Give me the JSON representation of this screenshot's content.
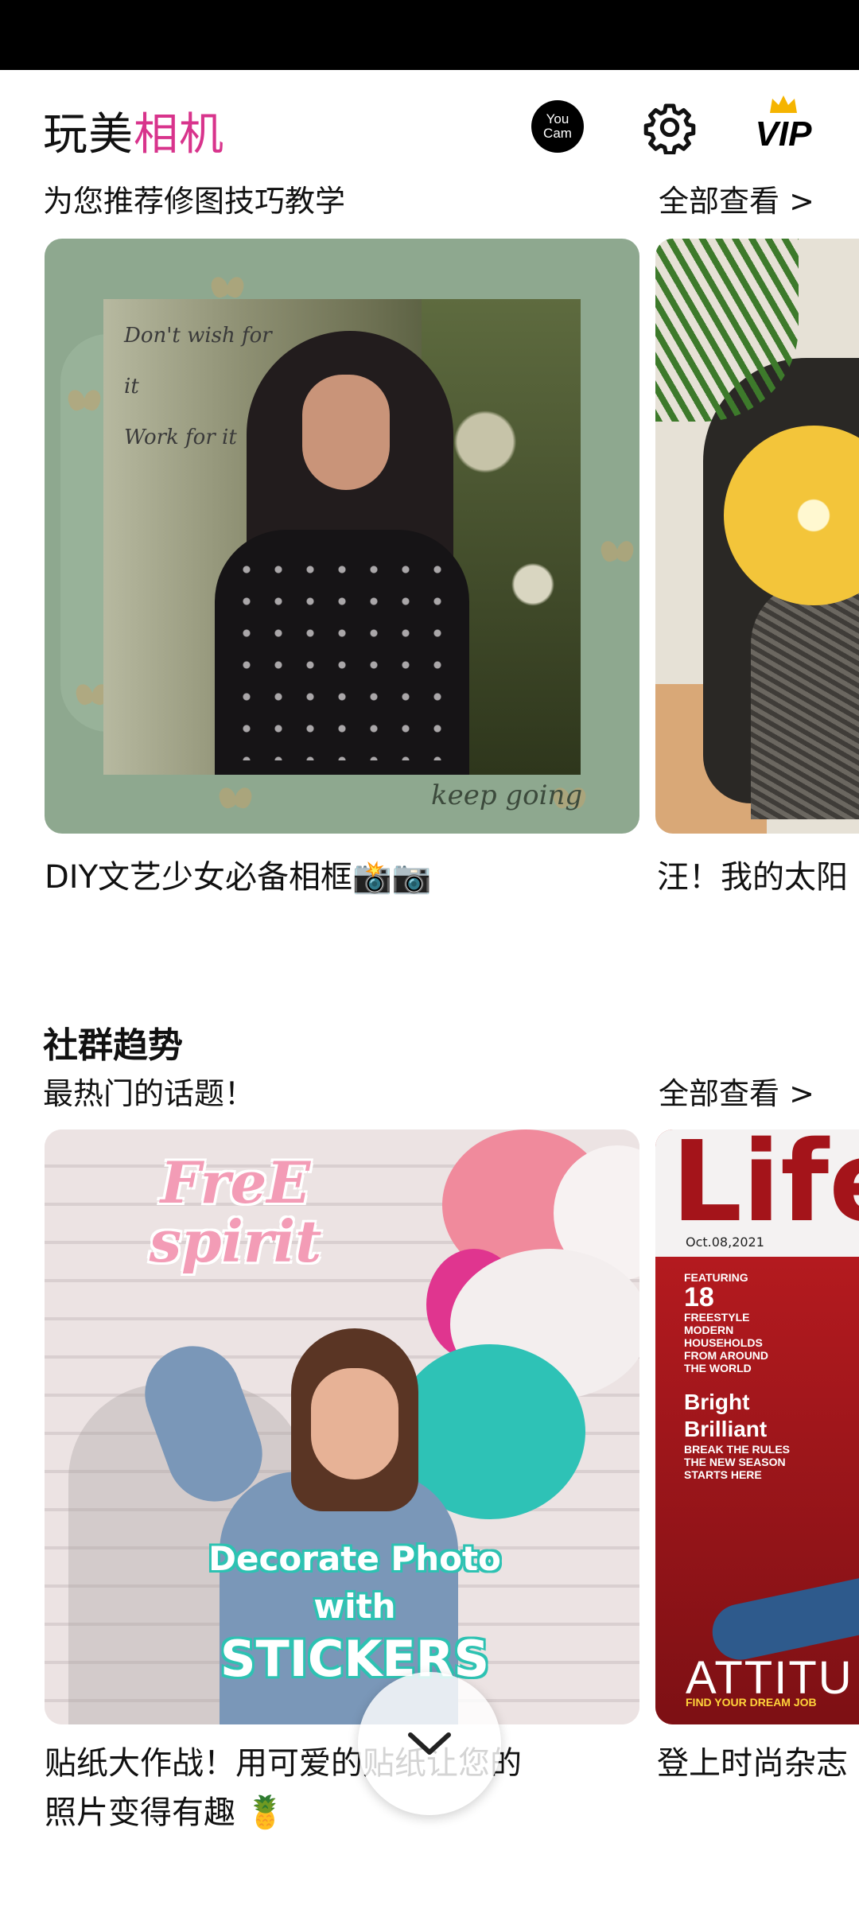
{
  "header": {
    "title_part1": "玩美",
    "title_part2": "相机",
    "youcam_label": "You Cam",
    "vip_label": "VIP"
  },
  "tutorials": {
    "subtitle": "为您推荐修图技巧教学",
    "see_all": "全部查看 >",
    "cards": [
      {
        "caption": "DIY文艺少女必备相框📸📷",
        "overlay_lines": [
          "Don't wish for it",
          "Work for it"
        ],
        "overlay_footer": "keep going"
      },
      {
        "caption": "汪！我的太阳"
      }
    ]
  },
  "trends": {
    "heading": "社群趋势",
    "subtitle": "最热门的话题！",
    "see_all": "全部查看 >",
    "cards": [
      {
        "caption_line1": "贴纸大作战！用可爱的贴纸让您的",
        "caption_line2": "照片变得有趣 🍍",
        "sticker_top": "FreE spirit",
        "sticker_line1": "Decorate Photo",
        "sticker_line2": "with",
        "sticker_line3": "STICKERS"
      },
      {
        "caption": "登上时尚杂志",
        "mag_title": "Life",
        "mag_date": "Oct.08,2021",
        "mag_featuring": "FEATURING",
        "mag_number": "18",
        "mag_list": "FREESTYLE MODERN HOUSEHOLDS FROM AROUND THE WORLD",
        "mag_bright": "Bright",
        "mag_brilliant": "Brilliant",
        "mag_rules": "BREAK THE RULES THE NEW SEASON STARTS HERE",
        "mag_attitude": "ATTITU",
        "mag_dream": "FIND YOUR DREAM JOB"
      }
    ]
  },
  "colors": {
    "accent": "#d8348c",
    "text": "#111111",
    "status_bar": "#000000"
  },
  "icons": {
    "youcam": "youcam-logo-icon",
    "settings": "gear-icon",
    "vip": "vip-crown-icon",
    "scroll": "chevron-down-icon"
  }
}
